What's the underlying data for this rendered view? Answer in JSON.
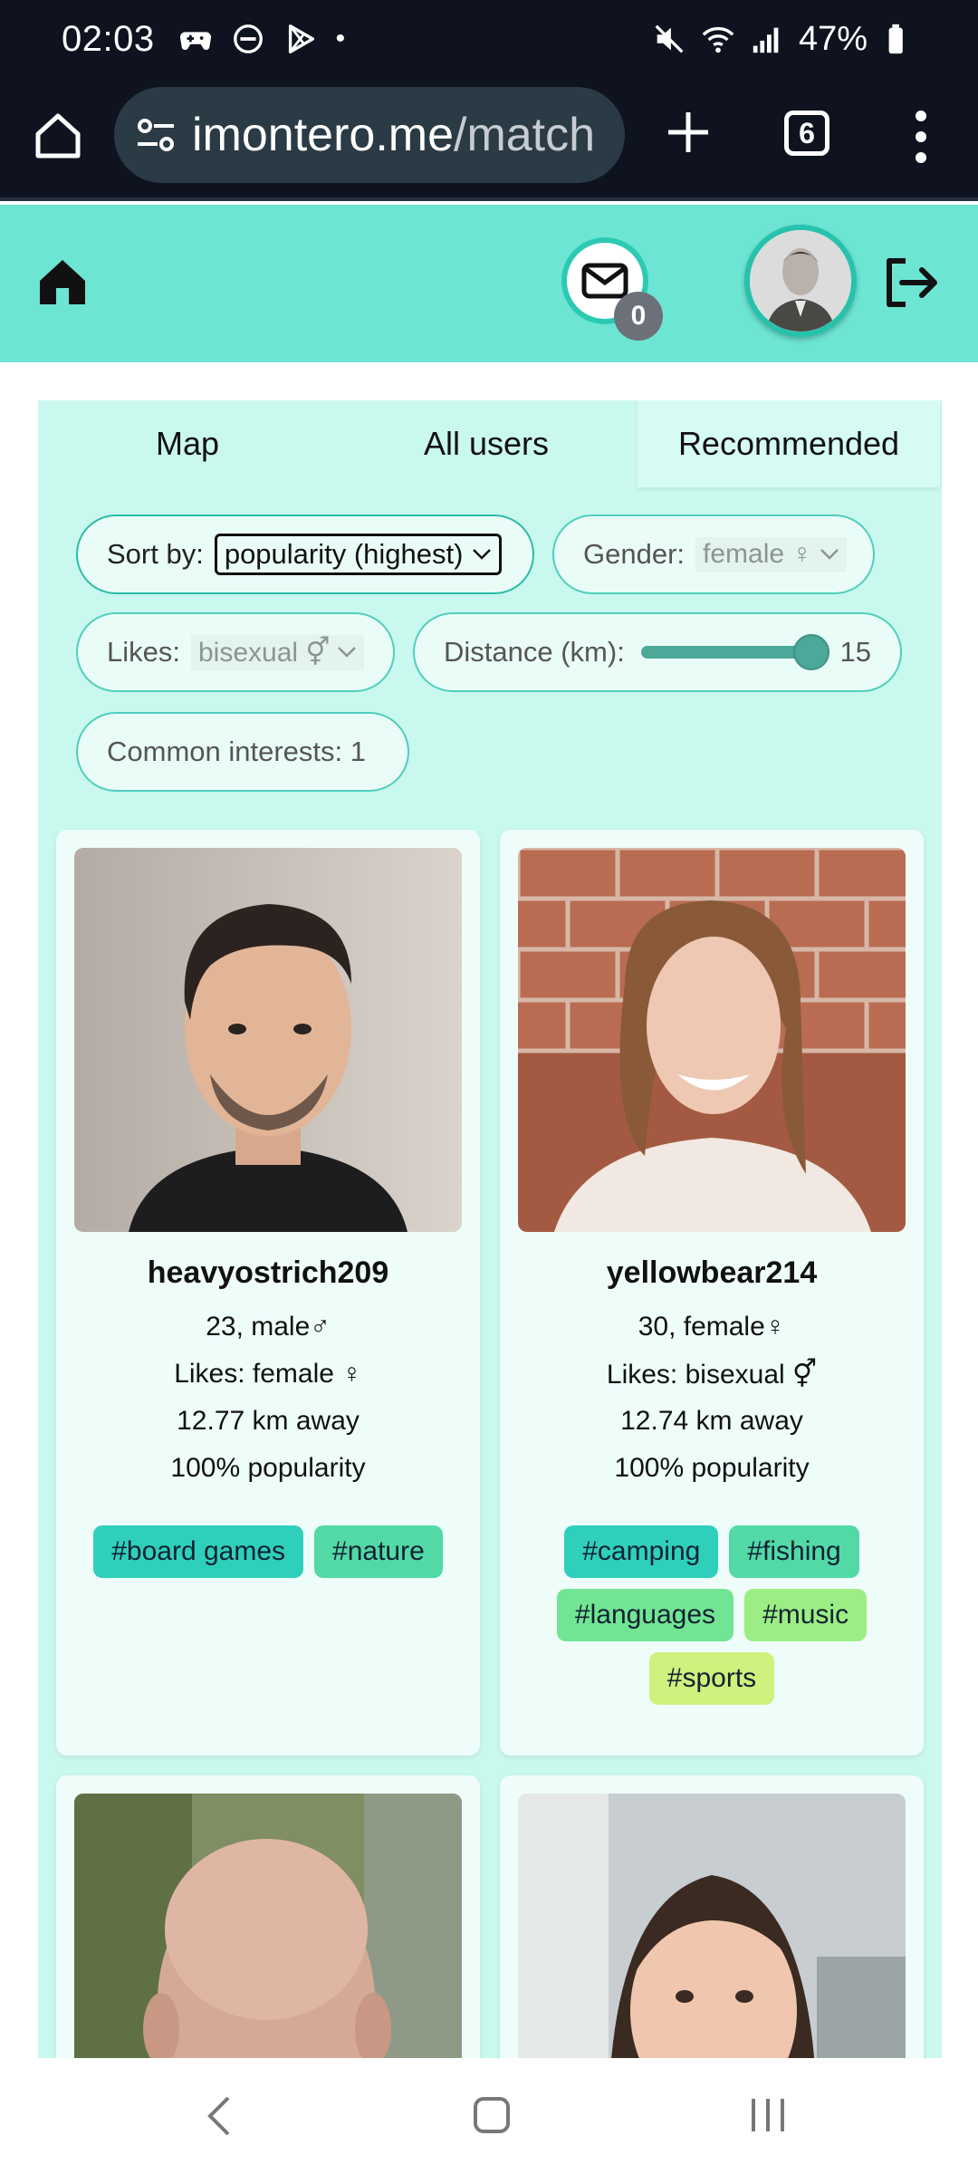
{
  "status_bar": {
    "time": "02:03",
    "battery": "47%"
  },
  "browser": {
    "url_domain": "imontero.me",
    "url_path": "/match",
    "tab_count": "6"
  },
  "header": {
    "unread_count": "0"
  },
  "tabs": [
    {
      "label": "Map"
    },
    {
      "label": "All users"
    },
    {
      "label": "Recommended"
    }
  ],
  "filters": {
    "sort_label": "Sort by:",
    "sort_value": "popularity (highest)",
    "gender_label": "Gender:",
    "gender_value": "female ♀",
    "likes_label": "Likes:",
    "likes_value": "bisexual ⚥",
    "distance_label": "Distance (km):",
    "distance_value": "15",
    "distance_level": 1.0,
    "common_interests": "Common interests: 1"
  },
  "users": [
    {
      "username": "heavyostrich209",
      "age_gender": "23, male♂",
      "likes": "Likes: female ♀",
      "distance": "12.77 km away",
      "popularity": "100% popularity",
      "tags": [
        "#board games",
        "#nature"
      ]
    },
    {
      "username": "yellowbear214",
      "age_gender": "30, female♀",
      "likes": "Likes: bisexual ⚥",
      "distance": "12.74 km away",
      "popularity": "100% popularity",
      "tags": [
        "#camping",
        "#fishing",
        "#languages",
        "#music",
        "#sports"
      ]
    }
  ],
  "colors": {
    "header_bg": "#6de5d3",
    "panel_bg": "#c9f8ee",
    "accent": "#2ccab3",
    "tag_palette": [
      "#2fd0bb",
      "#52d9a6",
      "#72e594",
      "#9cee84",
      "#cdf27d"
    ]
  },
  "icons": {
    "header": [
      "home-icon",
      "mail-icon",
      "avatar",
      "logout-icon"
    ],
    "browser": [
      "browser-home-icon",
      "site-settings-icon",
      "new-tab-icon",
      "tab-switcher-icon",
      "overflow-menu-icon"
    ],
    "nav": [
      "back-icon",
      "home-nav-icon",
      "recents-icon"
    ]
  }
}
